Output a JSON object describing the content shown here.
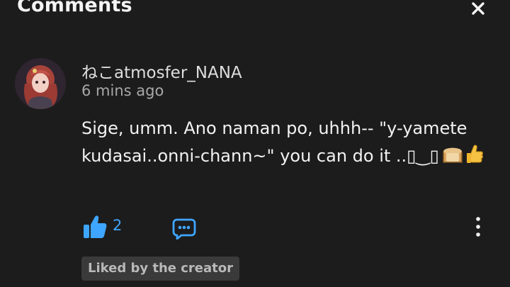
{
  "header": {
    "title": "Comments",
    "close_icon": "close-icon"
  },
  "comment": {
    "avatar_icon": "user-avatar",
    "username": "ねこatmosfer_NANA",
    "time": "6 mins ago",
    "text": "Sige, umm. Ano naman po, uhhh-- \"y-yamete kudasai..onni-chann~\" you can do it ..▯‿▯",
    "emojis": [
      "bread-emoji",
      "thumbs-up-emoji"
    ],
    "like_count": "2",
    "badge": "Liked by the creator"
  },
  "colors": {
    "background": "#1c1c1c",
    "accent": "#3ea6ff",
    "badge_bg": "#3a3a3a"
  }
}
